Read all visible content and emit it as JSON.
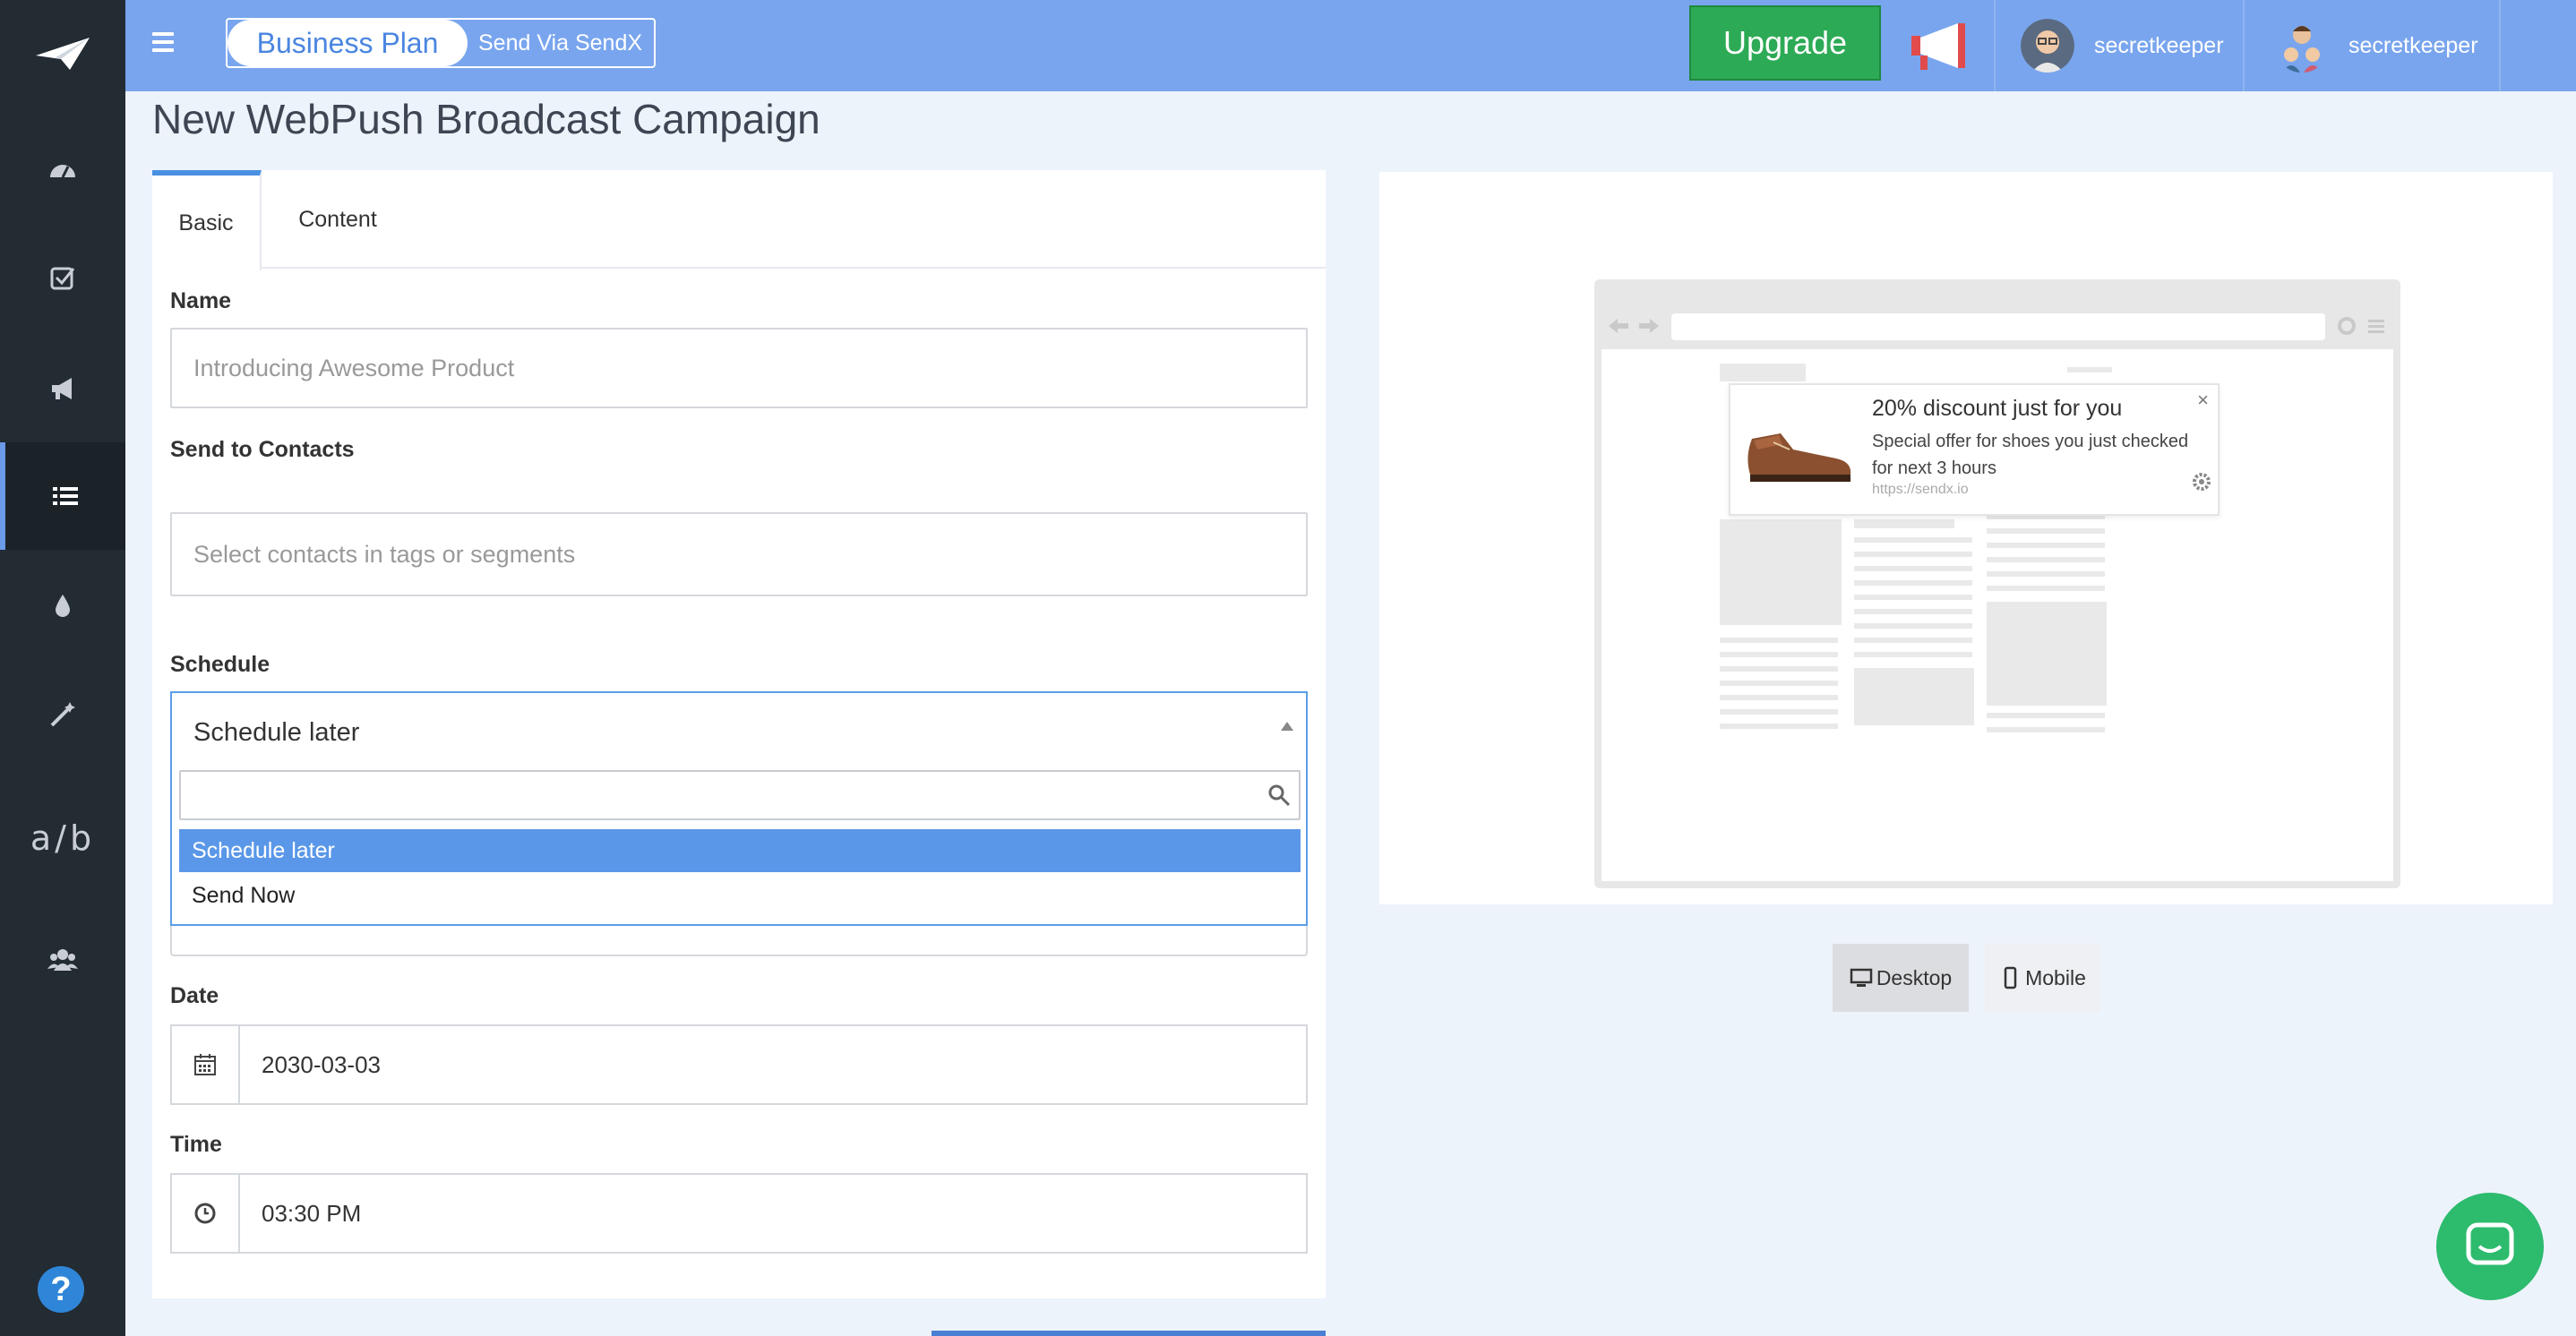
{
  "topbar": {
    "plan_name": "Business Plan",
    "plan_sub": "Send Via SendX",
    "upgrade_label": "Upgrade",
    "users": [
      {
        "name": "secretkeeper"
      },
      {
        "name": "secretkeeper"
      }
    ]
  },
  "sidebar": {
    "ab_label": "a/b",
    "help_label": "?"
  },
  "page": {
    "title": "New WebPush Broadcast Campaign"
  },
  "tabs": [
    {
      "label": "Basic"
    },
    {
      "label": "Content"
    }
  ],
  "form": {
    "name_label": "Name",
    "name_placeholder": "Introducing Awesome Product",
    "contacts_label": "Send to Contacts",
    "contacts_placeholder": "Select contacts in tags or segments",
    "schedule_label": "Schedule",
    "schedule_value": "Schedule later",
    "schedule_options": [
      "Schedule later",
      "Send Now"
    ],
    "date_label": "Date",
    "date_value": "2030-03-03",
    "time_label": "Time",
    "time_value": "03:30 PM"
  },
  "preview": {
    "notif_title": "20% discount just for you",
    "notif_body": "Special offer for shoes you just checked for next 3 hours",
    "notif_url": "https://sendx.io",
    "notif_close": "×",
    "desktop_label": "Desktop",
    "mobile_label": "Mobile"
  },
  "colors": {
    "topbar": "#79a5ee",
    "sidebar": "#232b33",
    "upgrade": "#2daa55",
    "highlight": "#5a97e8",
    "chat": "#2dbb6e"
  }
}
